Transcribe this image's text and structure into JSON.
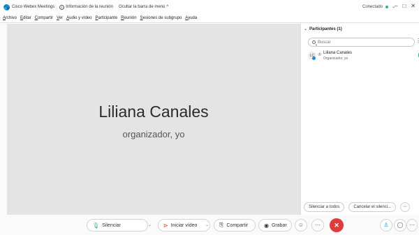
{
  "titlebar": {
    "app_name": "Cisco Webex Meetings",
    "meeting_info": "Información de la reunión",
    "hide_menu": "Ocultar la barra de menú",
    "status": "Conectado",
    "status_color": "#2eb872"
  },
  "menubar": {
    "items": [
      "Archivo",
      "Editar",
      "Compartir",
      "Ver",
      "Audio y vídeo",
      "Participante",
      "Reunión",
      "Sesiones de subgrupo",
      "Ayuda"
    ]
  },
  "main": {
    "speaker_name": "Liliana Canales",
    "speaker_role": "organizador, yo"
  },
  "panel": {
    "title": "Participantes (1)",
    "search_placeholder": "Buscar",
    "participant": {
      "initials": "LC",
      "name": "Liliana Canales",
      "role": "Organizador, yo"
    },
    "mute_all": "Silenciar a todos",
    "unmute_all": "Cancelar el silenci..."
  },
  "toolbar": {
    "mute": "Silenciar",
    "start_video": "Iniciar vídeo",
    "share": "Compartir",
    "record": "Grabar",
    "end_color": "#e03b3b",
    "accent_color": "#1d8cd8"
  }
}
